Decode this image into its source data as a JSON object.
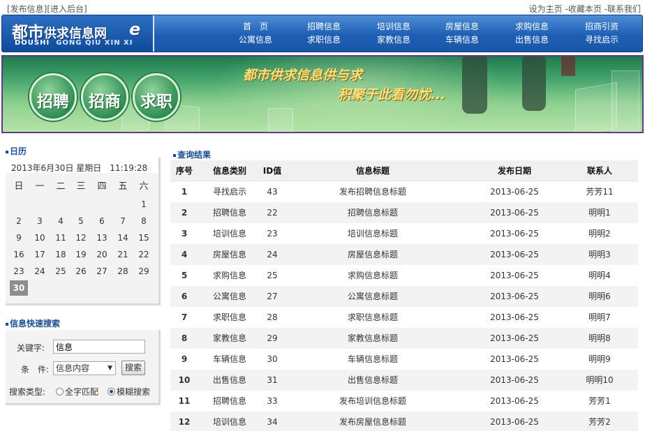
{
  "topbar": {
    "left_links": [
      "[发布信息]",
      "[进入后台]"
    ],
    "right_links": [
      "设为主页",
      "收藏本页",
      "联系我们"
    ],
    "separator": " -"
  },
  "logo": {
    "brand_big": "都市",
    "brand_small": "供求信息网",
    "mark": "e",
    "pinyin_1": "DOUSHI",
    "pinyin_2": "GONG QIU XIN XI"
  },
  "nav": {
    "columns": [
      [
        "首　页",
        "公寓信息"
      ],
      [
        "招聘信息",
        "求职信息"
      ],
      [
        "培训信息",
        "家教信息"
      ],
      [
        "房屋信息",
        "车辆信息"
      ],
      [
        "求购信息",
        "出售信息"
      ],
      [
        "招商引资",
        "寻找启示"
      ]
    ]
  },
  "banner": {
    "buttons": [
      "招聘",
      "招商",
      "求职"
    ],
    "slogan_1": "都市供求信息供与求",
    "slogan_2": "积聚于此看勿忧..."
  },
  "calendar": {
    "title": "日历",
    "caption": "2013年6月30日 星期日　11:19:28",
    "weekdays": [
      "日",
      "一",
      "二",
      "三",
      "四",
      "五",
      "六"
    ],
    "first_weekday_index": 6,
    "days_in_month": 30,
    "today": 30
  },
  "search": {
    "title": "信息快速搜索",
    "keyword_label": "关键字:",
    "keyword_value": "信息",
    "condition_label": "条　件:",
    "condition_value": "信息内容",
    "search_button": "搜索",
    "type_label": "搜索类型:",
    "type_options": [
      "全字匹配",
      "模糊搜索"
    ],
    "type_selected": "模糊搜索"
  },
  "results": {
    "title": "查询结果",
    "columns": [
      "序号",
      "信息类别",
      "ID值",
      "信息标题",
      "发布日期",
      "联系人"
    ],
    "rows": [
      [
        "1",
        "寻找启示",
        "43",
        "发布招聘信息标题",
        "2013-06-25",
        "芳芳11"
      ],
      [
        "2",
        "招聘信息",
        "22",
        "招聘信息标题",
        "2013-06-25",
        "明明1"
      ],
      [
        "3",
        "培训信息",
        "23",
        "培训信息标题",
        "2013-06-25",
        "明明2"
      ],
      [
        "4",
        "房屋信息",
        "24",
        "房屋信息标题",
        "2013-06-25",
        "明明3"
      ],
      [
        "5",
        "求购信息",
        "25",
        "求购信息标题",
        "2013-06-25",
        "明明4"
      ],
      [
        "6",
        "公寓信息",
        "27",
        "公寓信息标题",
        "2013-06-25",
        "明明6"
      ],
      [
        "7",
        "求职信息",
        "28",
        "求职信息标题",
        "2013-06-25",
        "明明7"
      ],
      [
        "8",
        "家教信息",
        "29",
        "家教信息标题",
        "2013-06-25",
        "明明8"
      ],
      [
        "9",
        "车辆信息",
        "30",
        "车辆信息标题",
        "2013-06-25",
        "明明9"
      ],
      [
        "10",
        "出售信息",
        "31",
        "出售信息标题",
        "2013-06-25",
        "明明10"
      ],
      [
        "11",
        "招聘信息",
        "33",
        "发布培训信息标题",
        "2013-06-25",
        "芳芳1"
      ],
      [
        "12",
        "培训信息",
        "34",
        "发布房屋信息标题",
        "2013-06-25",
        "芳芳2"
      ]
    ]
  }
}
